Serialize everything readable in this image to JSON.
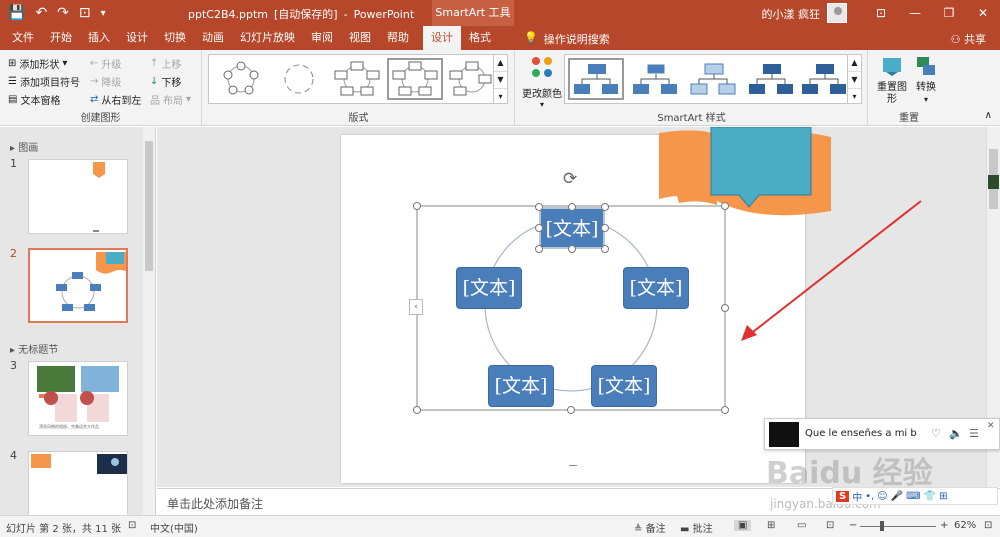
{
  "window": {
    "file_name": "pptC2B4.pptm",
    "autosave": "[自动保存的]",
    "separator": "-",
    "app": "PowerPoint",
    "context_tools": "SmartArt 工具",
    "user": "的小漾 疯狂",
    "controls": [
      "⊡",
      "—",
      "❐",
      "✕"
    ]
  },
  "qat": {
    "save": "💾",
    "undo": "↶",
    "redo": "↷",
    "present": "⊡",
    "customize": "▾"
  },
  "tabs": [
    "文件",
    "开始",
    "插入",
    "设计",
    "切换",
    "动画",
    "幻灯片放映",
    "审阅",
    "视图",
    "帮助",
    "设计",
    "格式"
  ],
  "tellme": "操作说明搜索",
  "share": "共享",
  "ribbon": {
    "create": {
      "label": "创建图形",
      "add_shape": "添加形状",
      "add_bullet": "添加项目符号",
      "text_pane": "文本窗格",
      "promote": "升级",
      "demote": "降级",
      "rtl": "从右到左",
      "move_up": "上移",
      "move_down": "下移",
      "layout": "布局"
    },
    "layouts": {
      "label": "版式"
    },
    "styles": {
      "label": "SmartArt 样式",
      "change_colors": "更改颜色"
    },
    "reset": {
      "label": "重置",
      "reset_graphic": "重置图形",
      "convert": "转换"
    }
  },
  "thumbs": {
    "section1": "图画",
    "section2": "无标题节",
    "slides": [
      "1",
      "2",
      "3",
      "4"
    ],
    "slide3_caption": "漂亮风格的相册，完美适合大作品"
  },
  "smartart": {
    "nodes": [
      "[文本]",
      "[文本]",
      "[文本]",
      "[文本]",
      "[文本]"
    ]
  },
  "notes_placeholder": "单击此处添加备注",
  "media": {
    "song": "Que le enseñes a mi boca"
  },
  "watermark": {
    "brand": "Baidu 经验",
    "url": "jingyan.baidu.com"
  },
  "ime": {
    "logo": "S",
    "lang": "中",
    "items": [
      "•,",
      "☺",
      "🎤",
      "⌨",
      "👕",
      "⊞"
    ]
  },
  "status": {
    "slide_info": "幻灯片 第 2 张，共 11 张",
    "language": "中文(中国)",
    "notes": "备注",
    "comments": "批注",
    "zoom": "62%",
    "zoom_minus": "−",
    "zoom_plus": "+"
  },
  "colors": {
    "accent": "#b7472a",
    "node": "#4a7ebb",
    "banner": "#f5964a",
    "callout": "#4bacc6"
  }
}
